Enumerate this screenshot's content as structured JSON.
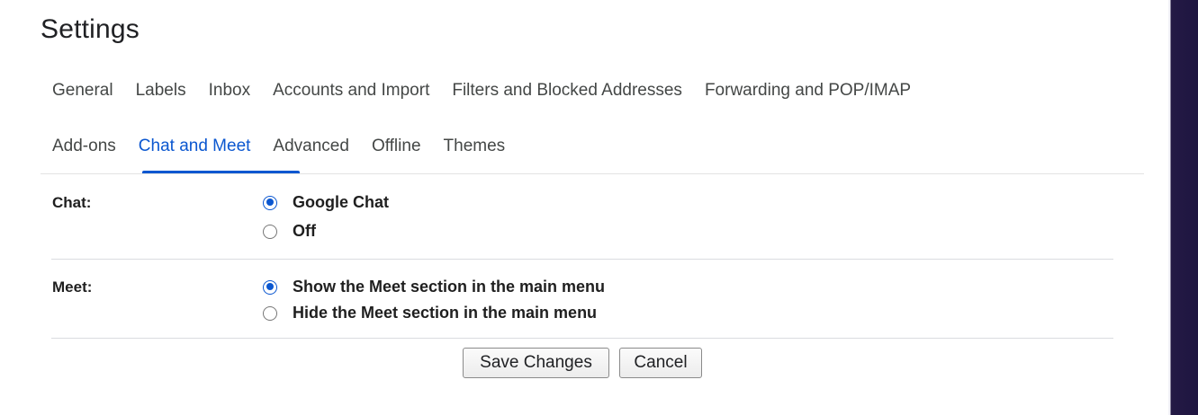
{
  "page": {
    "title": "Settings"
  },
  "tabs": {
    "row1": [
      {
        "label": "General"
      },
      {
        "label": "Labels"
      },
      {
        "label": "Inbox"
      },
      {
        "label": "Accounts and Import"
      },
      {
        "label": "Filters and Blocked Addresses"
      },
      {
        "label": "Forwarding and POP/IMAP"
      }
    ],
    "row2": [
      {
        "label": "Add-ons"
      },
      {
        "label": "Chat and Meet",
        "active": true
      },
      {
        "label": "Advanced"
      },
      {
        "label": "Offline"
      },
      {
        "label": "Themes"
      }
    ]
  },
  "chat": {
    "label": "Chat:",
    "options": [
      {
        "label": "Google Chat",
        "selected": true
      },
      {
        "label": "Off",
        "selected": false
      }
    ]
  },
  "meet": {
    "label": "Meet:",
    "options": [
      {
        "label": "Show the Meet section in the main menu",
        "selected": true
      },
      {
        "label": "Hide the Meet section in the main menu",
        "selected": false
      }
    ]
  },
  "actions": {
    "save_label": "Save Changes",
    "cancel_label": "Cancel"
  },
  "colors": {
    "accent": "#0b57d0",
    "text": "#1f1f1f",
    "tab_text": "#444746",
    "divider": "#dadce0"
  }
}
